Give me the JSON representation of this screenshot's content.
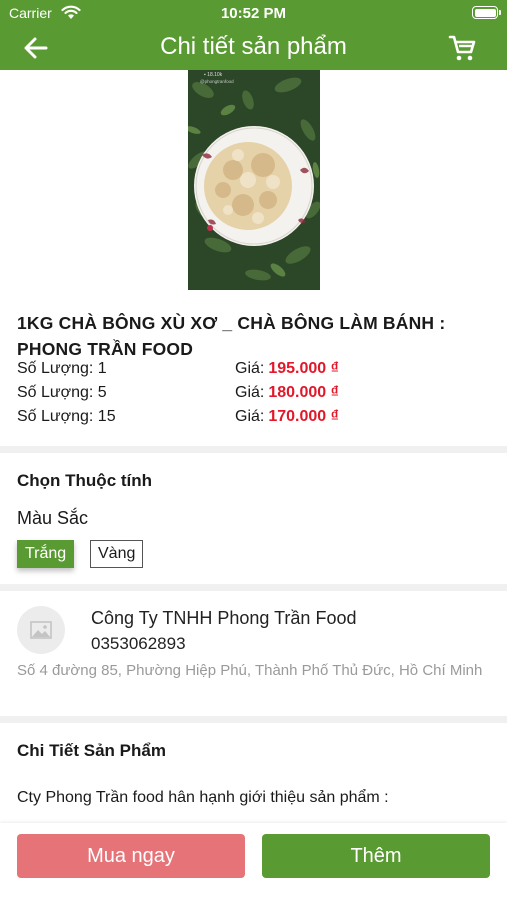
{
  "status_bar": {
    "carrier": "Carrier",
    "time": "10:52 PM"
  },
  "nav": {
    "title": "Chi tiết sản phẩm",
    "back_icon": "back-arrow-icon",
    "cart_icon": "cart-icon"
  },
  "product": {
    "name": "1KG CHÀ BÔNG XÙ XƠ _ CHÀ BÔNG LÀM BÁNH : PHONG TRẦN FOOD",
    "prices": [
      {
        "qty": "Số Lượng: 1",
        "label": "Giá:",
        "price": "195.000 ₫"
      },
      {
        "qty": "Số Lượng: 5",
        "label": "Giá:",
        "price": "180.000 ₫"
      },
      {
        "qty": "Số Lượng: 15",
        "label": "Giá:",
        "price": "170.000 ₫"
      }
    ]
  },
  "attributes": {
    "title": "Chọn Thuộc tính",
    "color_label": "Màu Sắc",
    "options": [
      "Trắng",
      "Vàng"
    ],
    "selected": "Trắng"
  },
  "shop": {
    "name": "Công Ty TNHH Phong Trần Food",
    "phone": "0353062893",
    "address": "Số 4 đường 85, Phường Hiệp Phú, Thành Phố Thủ Đức, Hồ Chí Minh"
  },
  "details": {
    "title": "Chi Tiết Sản Phẩm",
    "text": "Cty Phong Trần food hân hạnh giới thiệu sản phẩm :"
  },
  "actions": {
    "buy_now": "Mua ngay",
    "add": "Thêm"
  },
  "colors": {
    "brand_green": "#5a9a32",
    "price_red": "#e3172a",
    "buy_button": "#e57378"
  }
}
